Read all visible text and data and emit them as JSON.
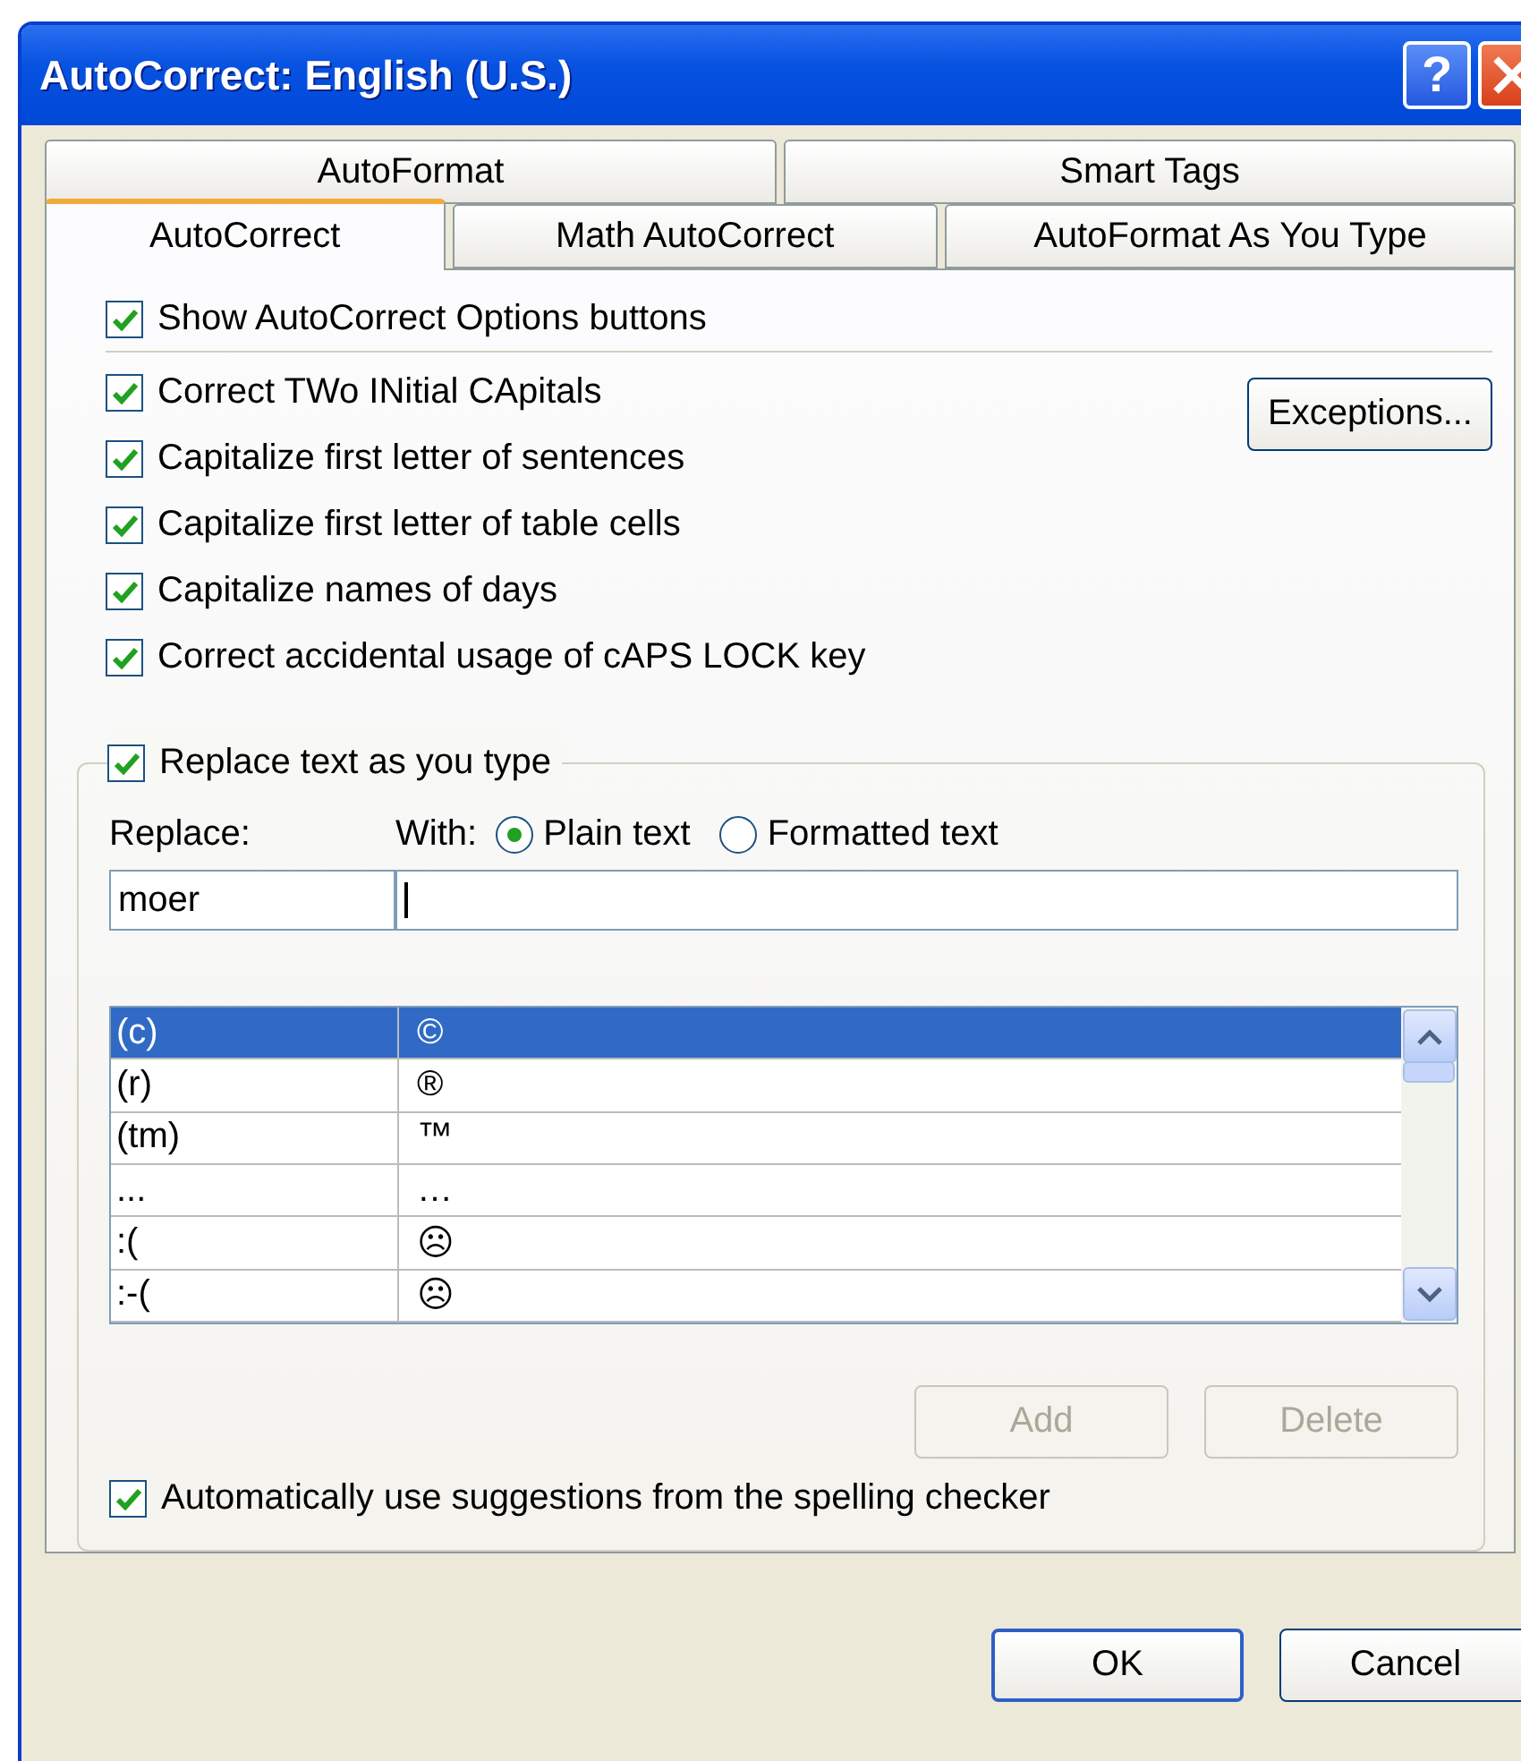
{
  "window": {
    "title": "AutoCorrect: English (U.S.)",
    "help": "?"
  },
  "tab_rows": [
    [
      {
        "label": "AutoFormat",
        "selected": false
      },
      {
        "label": "Smart Tags",
        "selected": false
      }
    ],
    [
      {
        "label": "AutoCorrect",
        "selected": true
      },
      {
        "label": "Math AutoCorrect",
        "selected": false
      },
      {
        "label": "AutoFormat As You Type",
        "selected": false
      }
    ]
  ],
  "show_options": {
    "label": "Show AutoCorrect Options buttons",
    "checked": true
  },
  "exceptions_button": "Exceptions...",
  "options": [
    {
      "label": "Correct TWo INitial CApitals",
      "checked": true
    },
    {
      "label": "Capitalize first letter of sentences",
      "checked": true
    },
    {
      "label": "Capitalize first letter of table cells",
      "checked": true
    },
    {
      "label": "Capitalize names of days",
      "checked": true
    },
    {
      "label": "Correct accidental usage of cAPS LOCK key",
      "checked": true
    }
  ],
  "replace_group": {
    "label": "Replace text as you type",
    "checked": true,
    "replace_label": "Replace:",
    "with_label": "With:",
    "format_options": [
      {
        "label": "Plain text",
        "selected": true
      },
      {
        "label": "Formatted text",
        "selected": false
      }
    ],
    "replace_value": "moer",
    "entries": [
      {
        "replace": "(c)",
        "with": "©",
        "selected": true
      },
      {
        "replace": "(r)",
        "with": "®",
        "selected": false
      },
      {
        "replace": "(tm)",
        "with": "™",
        "selected": false
      },
      {
        "replace": "...",
        "with": "…",
        "selected": false
      },
      {
        "replace": ":(",
        "with": "☹",
        "selected": false
      },
      {
        "replace": ":-(",
        "with": "☹",
        "selected": false
      }
    ],
    "buttons": [
      {
        "label": "Add",
        "disabled": true
      },
      {
        "label": "Delete",
        "disabled": true
      }
    ],
    "spelling": {
      "label": "Automatically use suggestions from the spelling checker",
      "checked": true
    }
  },
  "dialog_buttons": [
    {
      "label": "OK",
      "default": true
    },
    {
      "label": "Cancel",
      "default": false
    }
  ]
}
